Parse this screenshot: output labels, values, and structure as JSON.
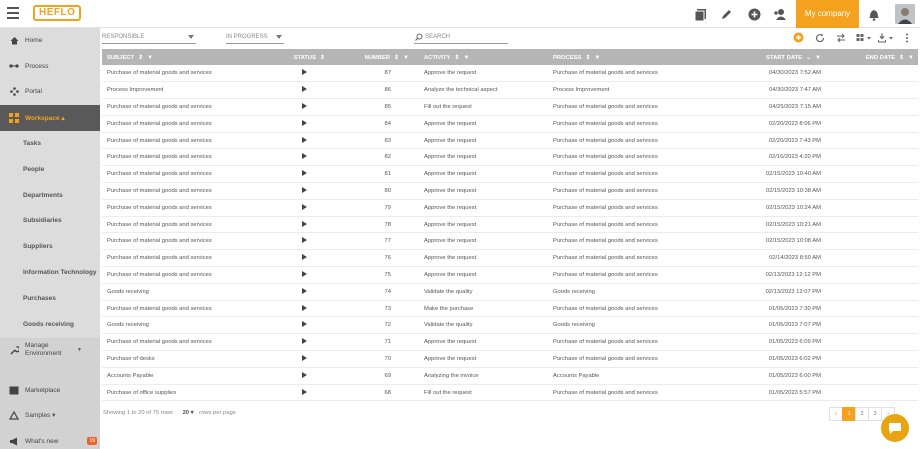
{
  "app": {
    "logo_text": "HEFLO",
    "company_button": "My company"
  },
  "colors": {
    "accent": "#f4a21d",
    "sidebar": "#dcdcdc",
    "sidebar_active": "#595959",
    "table_header": "#b5b5b5"
  },
  "topbar_icons": [
    "report-icon",
    "edit-icon",
    "add-circle-icon",
    "add-user-icon",
    "bell-icon",
    "avatar"
  ],
  "sidebar": {
    "items": [
      {
        "label": "Home",
        "icon": "home-icon"
      },
      {
        "label": "Process",
        "icon": "process-icon"
      },
      {
        "label": "Portal",
        "icon": "portal-icon"
      },
      {
        "label": "Workspace ▴",
        "icon": "workspace-icon"
      },
      {
        "label": "Tasks"
      },
      {
        "label": "People"
      },
      {
        "label": "Departments"
      },
      {
        "label": "Subsidiaries"
      },
      {
        "label": "Suppliers"
      },
      {
        "label": "Information Technology"
      },
      {
        "label": "Purchases"
      },
      {
        "label": "Goods receiving"
      },
      {
        "label": "Manage Environment",
        "icon": "wrench-icon"
      },
      {
        "label": "Marketplace",
        "icon": "marketplace-icon"
      },
      {
        "label": "Samples ▾",
        "icon": "samples-icon"
      },
      {
        "label": "What's new",
        "icon": "megaphone-icon",
        "badge": "19"
      }
    ]
  },
  "filters": {
    "responsible": "RESPONSIBLE",
    "status": "IN PROGRESS",
    "search_placeholder": "SEARCH"
  },
  "table": {
    "columns": [
      "SUBJECT",
      "STATUS",
      "NUMBER",
      "ACTIVITY",
      "PROCESS",
      "START DATE",
      "END DATE"
    ],
    "rows": [
      [
        "Purchase of material goods and services",
        "87",
        "Approve the request",
        "Purchase of material goods and services",
        "04/30/2023 7:52 AM"
      ],
      [
        "Process Improvement",
        "86",
        "Analyze the technical aspect",
        "Process Improvement",
        "04/30/2023 7:47 AM"
      ],
      [
        "Purchase of material goods and services",
        "85",
        "Fill out the request",
        "Purchase of material goods and services",
        "04/25/2023 7:15 AM"
      ],
      [
        "Purchase of material goods and services",
        "84",
        "Approve the request",
        "Purchase of material goods and services",
        "02/20/2023 8:06 PM"
      ],
      [
        "Purchase of material goods and services",
        "83",
        "Approve the request",
        "Purchase of material goods and services",
        "02/20/2023 7:43 PM"
      ],
      [
        "Purchase of material goods and services",
        "82",
        "Approve the request",
        "Purchase of material goods and services",
        "02/16/2023 4:20 PM"
      ],
      [
        "Purchase of material goods and services",
        "81",
        "Approve the request",
        "Purchase of material goods and services",
        "02/15/2023 10:40 AM"
      ],
      [
        "Purchase of material goods and services",
        "80",
        "Approve the request",
        "Purchase of material goods and services",
        "02/15/2023 10:38 AM"
      ],
      [
        "Purchase of material goods and services",
        "79",
        "Approve the request",
        "Purchase of material goods and services",
        "02/15/2023 10:24 AM"
      ],
      [
        "Purchase of material goods and services",
        "78",
        "Approve the request",
        "Purchase of material goods and services",
        "02/15/2023 10:21 AM"
      ],
      [
        "Purchase of material goods and services",
        "77",
        "Approve the request",
        "Purchase of material goods and services",
        "02/15/2023 10:08 AM"
      ],
      [
        "Purchase of material goods and services",
        "76",
        "Approve the request",
        "Purchase of material goods and services",
        "02/14/2023 8:50 AM"
      ],
      [
        "Purchase of material goods and services",
        "75",
        "Approve the request",
        "Purchase of material goods and services",
        "02/13/2023 12:12 PM"
      ],
      [
        "Goods receiving",
        "74",
        "Validate the quality",
        "Goods receiving",
        "02/13/2023 12:07 PM"
      ],
      [
        "Purchase of material goods and services",
        "73",
        "Make the purchase",
        "Purchase of material goods and services",
        "01/05/2023 7:30 PM"
      ],
      [
        "Goods receiving",
        "72",
        "Validate the quality",
        "Goods receiving",
        "01/05/2023 7:07 PM"
      ],
      [
        "Purchase of material goods and services",
        "71",
        "Approve the request",
        "Purchase of material goods and services",
        "01/05/2023 6:09 PM"
      ],
      [
        "Purchase of desks",
        "70",
        "Approve the request",
        "Purchase of material goods and services",
        "01/05/2023 6:02 PM"
      ],
      [
        "Accounts Payable",
        "69",
        "Analyzing the invoice",
        "Accounts Payable",
        "01/05/2023 6:00 PM"
      ],
      [
        "Purchase of office supplies",
        "68",
        "Fill out the request",
        "Purchase of material goods and services",
        "01/05/2023 5:57 PM"
      ]
    ]
  },
  "footer": {
    "showing": "Showing 1 to 20 of 75 rows",
    "per_page": "20 ▾",
    "per_page_label": "rows per page"
  },
  "pagination": {
    "prev": "‹",
    "pages": [
      "1",
      "2",
      "3"
    ],
    "next": "›",
    "current": "1"
  }
}
